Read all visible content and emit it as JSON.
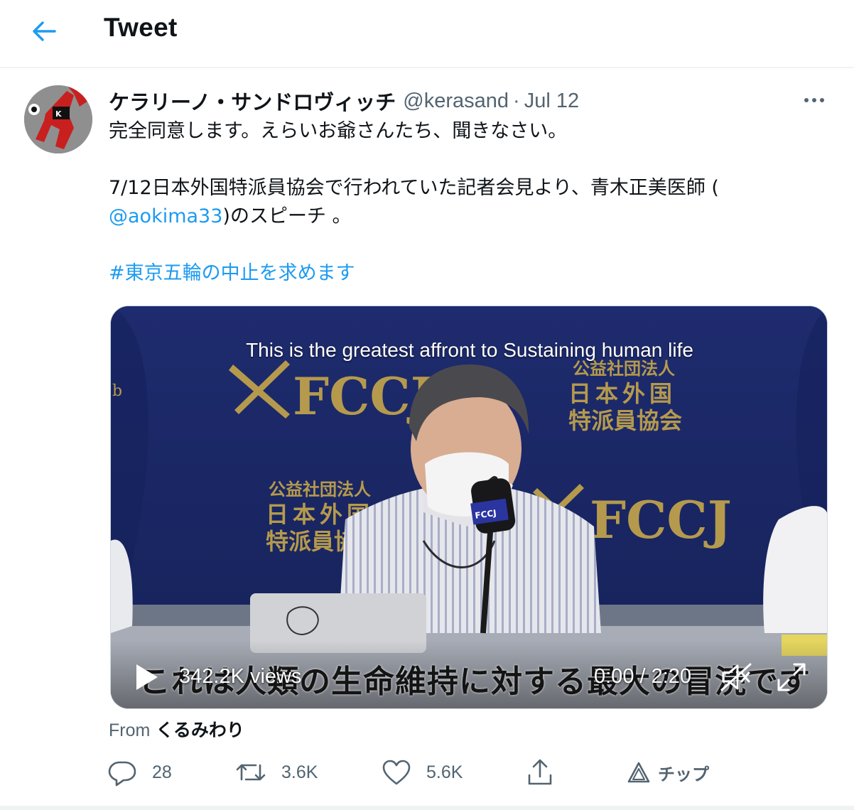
{
  "header": {
    "back_icon": "arrow-left-icon",
    "title": "Tweet"
  },
  "tweet": {
    "display_name": "ケラリーノ・サンドロヴィッチ",
    "handle": "@kerasand",
    "separator": "·",
    "date": "Jul 12",
    "text_line1": "完全同意します。えらいお爺さんたち、聞きなさい。",
    "text_line3": "7/12日本外国特派員協会で行われていた記者会見より、青木正美医師 (",
    "mention": "@aokima33",
    "text_line4_rest": ")のスピーチ 。",
    "hashtag": "#東京五輪の中止を求めます"
  },
  "media": {
    "top_caption": "This is the greatest affront to Sustaining human life",
    "subtitle": "これは人類の生命維持に対する最大の冒涜です",
    "views": "342.2K views",
    "time": "0:00 / 2:20",
    "mic_brand": "FCCJ",
    "banner_brand": "FCCJ",
    "banner_jp": [
      "公益社団法人",
      "日本外国",
      "特派員協会"
    ]
  },
  "source": {
    "from_label": "From",
    "source_name": "くるみわり"
  },
  "actions": {
    "reply_count": "28",
    "retweet_count": "3.6K",
    "like_count": "5.6K",
    "tip_label": "チップ"
  },
  "colors": {
    "accent": "#1d9bf0",
    "muted": "#536471",
    "banner": "#1d2a66",
    "gold": "#b59a4d"
  }
}
